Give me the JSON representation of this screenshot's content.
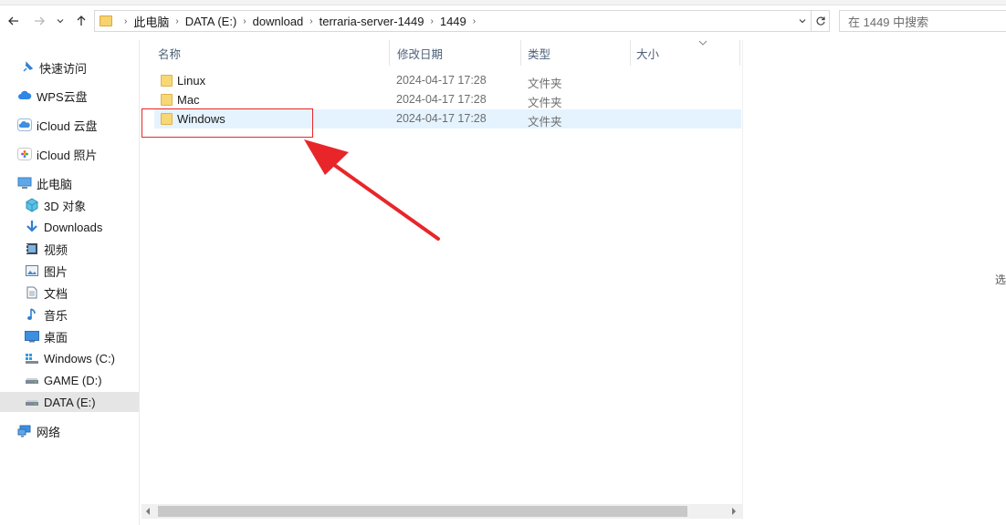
{
  "nav": {
    "back_icon": "arrow-left-icon",
    "forward_icon": "arrow-right-icon",
    "recent_icon": "chevron-down-icon",
    "up_icon": "arrow-up-icon"
  },
  "address": {
    "breadcrumbs": [
      "此电脑",
      "DATA (E:)",
      "download",
      "terraria-server-1449",
      "1449"
    ]
  },
  "search": {
    "placeholder": "在 1449 中搜索"
  },
  "sidebar": {
    "items": [
      {
        "label": "快速访问",
        "icon": "pin-icon"
      },
      {
        "label": "WPS云盘",
        "icon": "cloud-icon"
      },
      {
        "label": "iCloud 云盘",
        "icon": "icloud-icon"
      },
      {
        "label": "iCloud 照片",
        "icon": "photos-icon"
      },
      {
        "label": "此电脑",
        "icon": "computer-icon"
      },
      {
        "label": "3D 对象",
        "icon": "cube-icon"
      },
      {
        "label": "Downloads",
        "icon": "download-icon"
      },
      {
        "label": "视频",
        "icon": "video-icon"
      },
      {
        "label": "图片",
        "icon": "picture-icon"
      },
      {
        "label": "文档",
        "icon": "document-icon"
      },
      {
        "label": "音乐",
        "icon": "music-icon"
      },
      {
        "label": "桌面",
        "icon": "desktop-icon"
      },
      {
        "label": "Windows (C:)",
        "icon": "windows-drive-icon"
      },
      {
        "label": "GAME (D:)",
        "icon": "drive-icon"
      },
      {
        "label": "DATA (E:)",
        "icon": "drive-icon"
      },
      {
        "label": "网络",
        "icon": "network-icon"
      }
    ]
  },
  "columns": {
    "name": "名称",
    "date": "修改日期",
    "type": "类型",
    "size": "大小"
  },
  "files": [
    {
      "name": "Linux",
      "date": "2024-04-17 17:28",
      "type": "文件夹"
    },
    {
      "name": "Mac",
      "date": "2024-04-17 17:28",
      "type": "文件夹"
    },
    {
      "name": "Windows",
      "date": "2024-04-17 17:28",
      "type": "文件夹"
    }
  ],
  "side_stub": "选",
  "colors": {
    "accent": "#0078d4",
    "selection": "#e5f3ff",
    "annotation": "#e8262a",
    "folder": "#f8d775"
  }
}
